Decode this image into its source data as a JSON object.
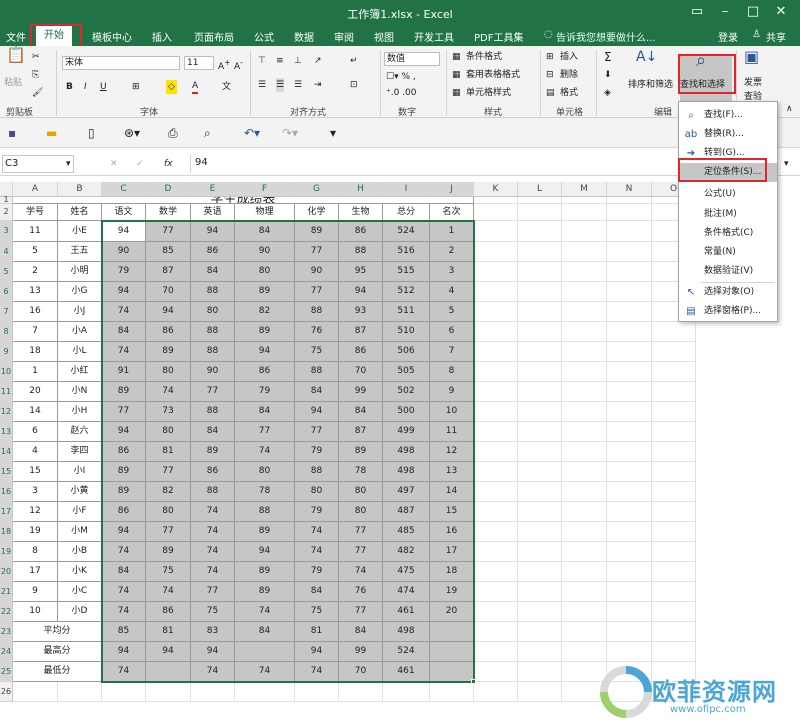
{
  "window": {
    "title": "工作簿1.xlsx - Excel",
    "login": "登录",
    "share": "共享"
  },
  "menu": {
    "tabs": [
      "文件",
      "开始",
      "模板中心",
      "插入",
      "页面布局",
      "公式",
      "数据",
      "审阅",
      "视图",
      "开发工具",
      "PDF工具集"
    ],
    "tell_me": "告诉我您想要做什么..."
  },
  "ribbon": {
    "clipboard": {
      "paste": "粘贴",
      "group": "剪贴板"
    },
    "font": {
      "name": "宋体",
      "size": "11",
      "group": "字体"
    },
    "alignment": {
      "group": "对齐方式"
    },
    "number": {
      "format": "数值",
      "group": "数字"
    },
    "styles": {
      "conditional": "条件格式",
      "table": "套用表格格式",
      "cell_styles": "单元格样式",
      "group": "样式"
    },
    "cells": {
      "insert": "插入",
      "delete": "删除",
      "format": "格式",
      "group": "单元格"
    },
    "editing": {
      "sort": "排序和筛选",
      "find": "查找和选择",
      "group": "编辑"
    },
    "invoice": {
      "label1": "发票",
      "label2": "查验"
    }
  },
  "formula_bar": {
    "name_box": "C3",
    "fx": "fx",
    "value": "94"
  },
  "columns": [
    "A",
    "B",
    "C",
    "D",
    "E",
    "F",
    "G",
    "H",
    "I",
    "J",
    "K",
    "L",
    "M",
    "N",
    "O"
  ],
  "rows": [
    "1",
    "2",
    "3",
    "4",
    "5",
    "6",
    "7",
    "8",
    "9",
    "10",
    "11",
    "12",
    "13",
    "14",
    "15",
    "16",
    "17",
    "18",
    "19",
    "20",
    "21",
    "22",
    "23",
    "24",
    "25",
    "26"
  ],
  "sheet": {
    "title": "学生成绩表",
    "headers": [
      "学号",
      "姓名",
      "语文",
      "数学",
      "英语",
      "物理",
      "化学",
      "生物",
      "总分",
      "名次"
    ],
    "students": [
      [
        "11",
        "小E",
        "94",
        "77",
        "94",
        "84",
        "89",
        "86",
        "524",
        "1"
      ],
      [
        "5",
        "王五",
        "90",
        "85",
        "86",
        "90",
        "77",
        "88",
        "516",
        "2"
      ],
      [
        "2",
        "小明",
        "79",
        "87",
        "84",
        "80",
        "90",
        "95",
        "515",
        "3"
      ],
      [
        "13",
        "小G",
        "94",
        "70",
        "88",
        "89",
        "77",
        "94",
        "512",
        "4"
      ],
      [
        "16",
        "小J",
        "74",
        "94",
        "80",
        "82",
        "88",
        "93",
        "511",
        "5"
      ],
      [
        "7",
        "小A",
        "84",
        "86",
        "88",
        "89",
        "76",
        "87",
        "510",
        "6"
      ],
      [
        "18",
        "小L",
        "74",
        "89",
        "88",
        "94",
        "75",
        "86",
        "506",
        "7"
      ],
      [
        "1",
        "小红",
        "91",
        "80",
        "90",
        "86",
        "88",
        "70",
        "505",
        "8"
      ],
      [
        "20",
        "小N",
        "89",
        "74",
        "77",
        "79",
        "84",
        "99",
        "502",
        "9"
      ],
      [
        "14",
        "小H",
        "77",
        "73",
        "88",
        "84",
        "94",
        "84",
        "500",
        "10"
      ],
      [
        "6",
        "赵六",
        "94",
        "80",
        "84",
        "77",
        "77",
        "87",
        "499",
        "11"
      ],
      [
        "4",
        "李四",
        "86",
        "81",
        "89",
        "74",
        "79",
        "89",
        "498",
        "12"
      ],
      [
        "15",
        "小I",
        "89",
        "77",
        "86",
        "80",
        "88",
        "78",
        "498",
        "13"
      ],
      [
        "3",
        "小黄",
        "89",
        "82",
        "88",
        "78",
        "80",
        "80",
        "497",
        "14"
      ],
      [
        "12",
        "小F",
        "86",
        "80",
        "74",
        "88",
        "79",
        "80",
        "487",
        "15"
      ],
      [
        "19",
        "小M",
        "94",
        "77",
        "74",
        "89",
        "74",
        "77",
        "485",
        "16"
      ],
      [
        "8",
        "小B",
        "74",
        "89",
        "74",
        "94",
        "74",
        "77",
        "482",
        "17"
      ],
      [
        "17",
        "小K",
        "84",
        "75",
        "74",
        "89",
        "79",
        "74",
        "475",
        "18"
      ],
      [
        "9",
        "小C",
        "74",
        "74",
        "77",
        "89",
        "84",
        "76",
        "474",
        "19"
      ],
      [
        "10",
        "小D",
        "74",
        "86",
        "75",
        "74",
        "75",
        "77",
        "461",
        "20"
      ]
    ],
    "summary": [
      [
        "平均分",
        "85",
        "81",
        "83",
        "84",
        "81",
        "84",
        "498",
        ""
      ],
      [
        "最高分",
        "94",
        "94",
        "94",
        "",
        "94",
        "99",
        "524",
        ""
      ],
      [
        "最低分",
        "74",
        "",
        "74",
        "74",
        "74",
        "70",
        "461",
        ""
      ]
    ]
  },
  "dropdown": {
    "items": [
      {
        "label": "查找(F)...",
        "icon": "search-icon"
      },
      {
        "label": "替换(R)...",
        "icon": "replace-icon"
      },
      {
        "label": "转到(G)...",
        "icon": "arrow-right-icon"
      },
      {
        "label": "定位条件(S)...",
        "icon": ""
      },
      {
        "label": "公式(U)",
        "icon": ""
      },
      {
        "label": "批注(M)",
        "icon": ""
      },
      {
        "label": "条件格式(C)",
        "icon": ""
      },
      {
        "label": "常量(N)",
        "icon": ""
      },
      {
        "label": "数据验证(V)",
        "icon": ""
      },
      {
        "label": "选择对象(O)",
        "icon": "cursor-icon"
      },
      {
        "label": "选择窗格(P)...",
        "icon": "pane-icon"
      }
    ]
  },
  "watermark": {
    "text": "欧菲资源网",
    "url": "www.ofipc.com"
  },
  "colors": {
    "excel_green": "#217346",
    "highlight_red": "#e0262b",
    "selection_gray": "#c6c6c6"
  }
}
